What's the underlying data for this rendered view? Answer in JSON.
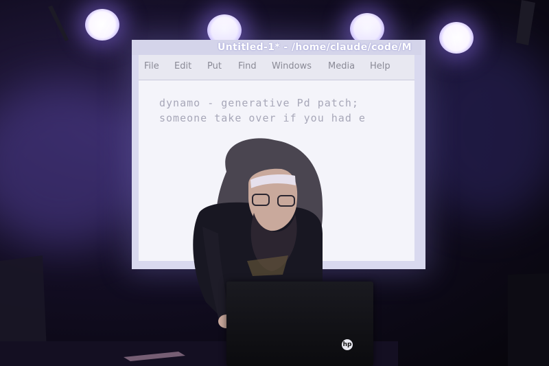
{
  "projection": {
    "window_title": "Untitled-1* - /home/claude/code/M",
    "menu": [
      "File",
      "Edit",
      "Put",
      "Find",
      "Windows",
      "Media",
      "Help"
    ],
    "code_lines": [
      "dynamo - generative Pd patch;",
      "someone take over if you had e"
    ]
  },
  "laptop": {
    "logo_text": "hp"
  },
  "colors": {
    "stage_light": "#9b7dff",
    "screen_bg": "#f4f4fa",
    "text": "#a7a7b8"
  }
}
